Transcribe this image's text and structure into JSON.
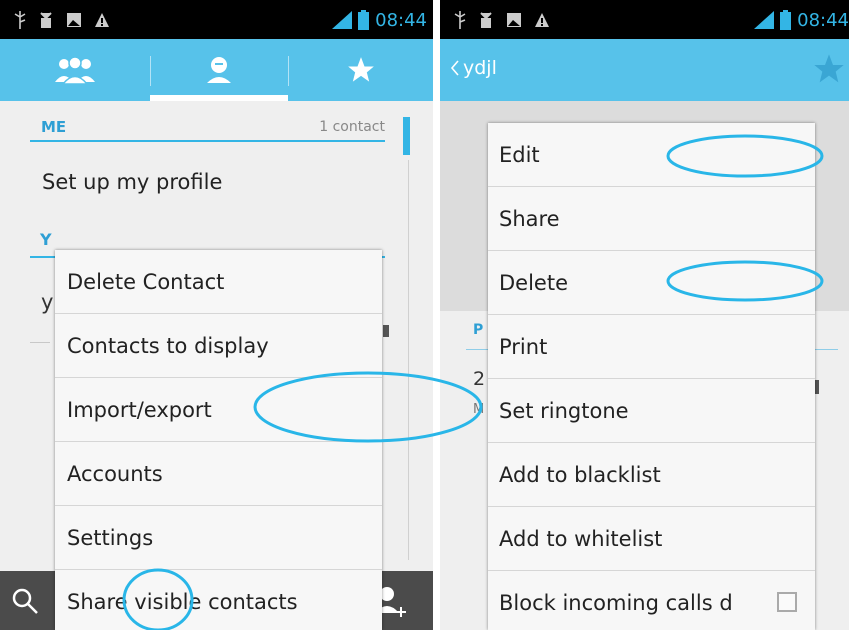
{
  "colors": {
    "accent": "#33b5e5",
    "action_bar": "#57c2ea",
    "bottom_bar": "#4b4b4b",
    "menu_bg": "#f7f7f7"
  },
  "status_bar": {
    "time": "08:44",
    "icons": [
      "usb-icon",
      "android-debug-icon",
      "photo-icon",
      "warning-icon",
      "signal-icon",
      "battery-icon"
    ]
  },
  "left": {
    "tabs": [
      "groups-icon",
      "person-icon",
      "star-icon"
    ],
    "selected_tab": 1,
    "me_section": {
      "label": "ME",
      "count": "1 contact"
    },
    "profile_text": "Set up my profile",
    "letter_section": "Y",
    "partial_row_text": "y",
    "bottom_icons": [
      "search-icon",
      "add-contact-icon"
    ],
    "menu": [
      {
        "label": "Delete Contact"
      },
      {
        "label": "Contacts to display"
      },
      {
        "label": "Import/export"
      },
      {
        "label": "Accounts"
      },
      {
        "label": "Settings"
      },
      {
        "label": "Share visible contacts"
      }
    ]
  },
  "right": {
    "contact_name": "ydjl",
    "section_label": "P",
    "fragment_line_1": "2",
    "fragment_line_2": "M",
    "menu": [
      {
        "label": "Edit"
      },
      {
        "label": "Share"
      },
      {
        "label": "Delete"
      },
      {
        "label": "Print"
      },
      {
        "label": "Set ringtone"
      },
      {
        "label": "Add to blacklist"
      },
      {
        "label": "Add to whitelist"
      },
      {
        "label": "Block incoming calls d",
        "checkbox": false
      }
    ]
  }
}
